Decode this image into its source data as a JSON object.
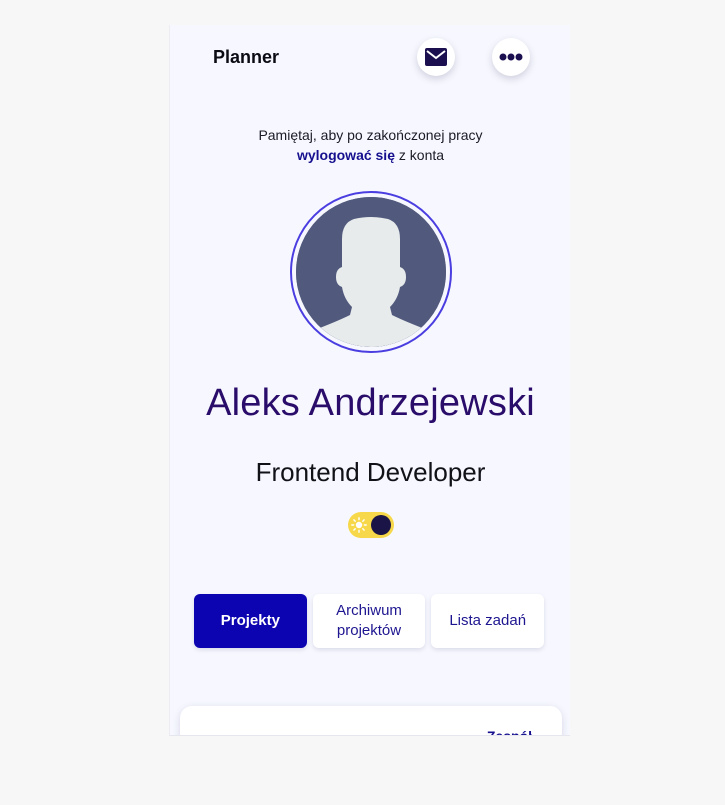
{
  "header": {
    "title": "Planner",
    "mail_icon": "mail-icon",
    "more_icon": "more-dots-icon"
  },
  "reminder": {
    "line1": "Pamiętaj, aby po zakończonej pracy",
    "link": "wylogować się",
    "after_link": " z konta"
  },
  "profile": {
    "avatar_icon": "user-silhouette-icon",
    "name": "Aleks Andrzejewski",
    "role": "Frontend Developer"
  },
  "theme_toggle": {
    "icon": "sun-icon",
    "state": "dark"
  },
  "tabs": [
    {
      "label": "Projekty",
      "active": true
    },
    {
      "label": "Archiwum projektów",
      "active": false
    },
    {
      "label": "Lista zadań",
      "active": false
    }
  ],
  "card": {
    "link_label": "Zespół"
  },
  "colors": {
    "accent": "#0c04b0",
    "name": "#2a0c6a",
    "link": "#16108f",
    "toggle_bg": "#f7d84a",
    "avatar_bg": "#515a7d"
  }
}
